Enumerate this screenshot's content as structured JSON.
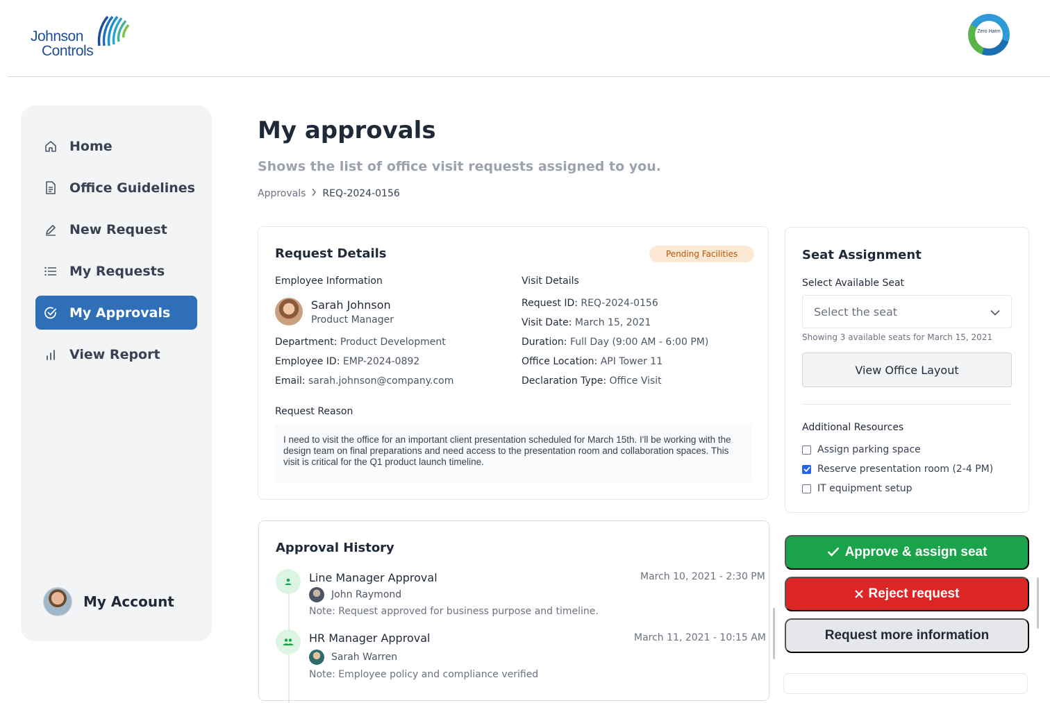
{
  "header": {
    "logo_line1": "Johnson",
    "logo_line2": "Controls",
    "badge_text": "Zero Harm"
  },
  "sidebar": {
    "items": [
      {
        "label": "Home",
        "icon": "home-icon"
      },
      {
        "label": "Office Guidelines",
        "icon": "document-icon"
      },
      {
        "label": "New Request",
        "icon": "pencil-icon"
      },
      {
        "label": "My Requests",
        "icon": "list-icon"
      },
      {
        "label": "My Approvals",
        "icon": "check-circle-icon",
        "active": true
      },
      {
        "label": "View Report",
        "icon": "bar-chart-icon"
      }
    ],
    "account_label": "My Account"
  },
  "page": {
    "title": "My approvals",
    "subtitle": "Shows the list of office visit requests assigned to you.",
    "breadcrumb_root": "Approvals",
    "breadcrumb_current": "REQ-2024-0156"
  },
  "request": {
    "title": "Request Details",
    "status": "Pending Facilities",
    "employee_section": "Employee Information",
    "visit_section": "Visit Details",
    "employee": {
      "name": "Sarah Johnson",
      "role": "Product Manager",
      "department_label": "Department:",
      "department": "Product Development",
      "id_label": "Employee ID:",
      "id": "EMP-2024-0892",
      "email_label": "Email:",
      "email": "sarah.johnson@company.com"
    },
    "visit": {
      "request_id_label": "Request ID:",
      "request_id": "REQ-2024-0156",
      "date_label": "Visit Date:",
      "date": "March 15, 2021",
      "duration_label": "Duration:",
      "duration": "Full Day (9:00 AM - 6:00 PM)",
      "location_label": "Office Location:",
      "location": "API Tower 11",
      "declaration_label": "Declaration Type:",
      "declaration": "Office Visit"
    },
    "reason_label": "Request Reason",
    "reason": "I need to visit the office for an important client presentation scheduled for March 15th. I'll be working with the design team on final preparations and need access to the presentation room and collaboration spaces. This visit is critical for the Q1 product launch timeline."
  },
  "history": {
    "title": "Approval History",
    "entries": [
      {
        "title": "Line Manager Approval",
        "date": "March 10, 2021 - 2:30 PM",
        "person": "John Raymond",
        "note": "Note: Request approved for business purpose and timeline.",
        "icon": "person-icon"
      },
      {
        "title": "HR Manager Approval",
        "date": "March 11, 2021 - 10:15 AM",
        "person": "Sarah Warren",
        "note": "Note: Employee policy and compliance verified",
        "icon": "group-icon"
      }
    ]
  },
  "seat": {
    "title": "Seat Assignment",
    "select_label": "Select Available Seat",
    "select_placeholder": "Select the seat",
    "hint": "Showing 3 available seats for March 15, 2021",
    "layout_button": "View Office Layout",
    "resources_label": "Additional Resources",
    "resources": [
      {
        "label": "Assign parking space",
        "checked": false
      },
      {
        "label": "Reserve presentation room (2-4 PM)",
        "checked": true
      },
      {
        "label": "IT equipment setup",
        "checked": false
      }
    ]
  },
  "actions": {
    "approve": "Approve & assign seat",
    "reject": "Reject request",
    "more_info": "Request more information"
  },
  "colors": {
    "nav_active": "#2f6fb8",
    "approve": "#1aa34a",
    "reject": "#dc2626",
    "status_pill_bg": "#fde8d4",
    "status_pill_text": "#b45309"
  }
}
